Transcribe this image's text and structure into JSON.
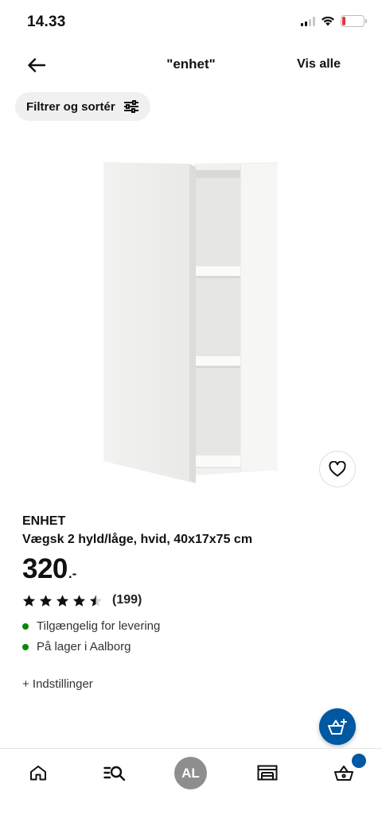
{
  "status_bar": {
    "time": "14.33",
    "battery": "20"
  },
  "header": {
    "title": "\"enhet\"",
    "see_all": "Vis alle"
  },
  "filter": {
    "label": "Filtrer og sortér"
  },
  "product": {
    "brand": "ENHET",
    "description": "Vægsk 2 hyld/låge, hvid, 40x17x75 cm",
    "price_integer": "320",
    "price_suffix": ".-",
    "rating_value": 4.5,
    "rating_max": 5,
    "rating_count": "(199)",
    "availability": [
      {
        "text": "Tilgængelig for levering",
        "status_color": "#0a8a00"
      },
      {
        "text": "På lager i Aalborg",
        "status_color": "#0a8a00"
      }
    ],
    "options_link": "+ Indstillinger"
  },
  "bottom_nav": {
    "items": [
      {
        "name": "home",
        "icon": "home-icon"
      },
      {
        "name": "search",
        "icon": "search-list-icon"
      },
      {
        "name": "profile",
        "icon": "avatar"
      },
      {
        "name": "store",
        "icon": "store-icon"
      },
      {
        "name": "basket",
        "icon": "basket-icon"
      }
    ],
    "avatar_initials": "AL"
  },
  "colors": {
    "brand_blue": "#0058a3",
    "availability_green": "#0a8a00",
    "chip_background": "#f0f0f0",
    "avatar_gray": "#8e8e8e",
    "battery_low": "#e0383e"
  }
}
